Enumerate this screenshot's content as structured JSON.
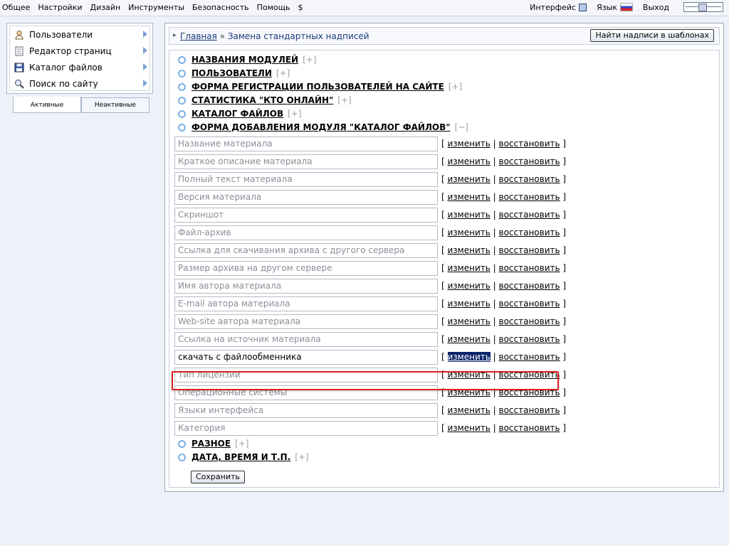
{
  "topmenu": [
    "Общее",
    "Настройки",
    "Дизайн",
    "Инструменты",
    "Безопасность",
    "Помощь",
    "$"
  ],
  "topright": {
    "interface_label": "Интерфейс",
    "language_label": "Язык",
    "logout_label": "Выход"
  },
  "sidebar": {
    "items": [
      {
        "label": "Пользователи",
        "icon": "user-icon"
      },
      {
        "label": "Редактор страниц",
        "icon": "page-icon"
      },
      {
        "label": "Каталог файлов",
        "icon": "disk-icon"
      },
      {
        "label": "Поиск по сайту",
        "icon": "search-icon"
      }
    ],
    "tabs": {
      "active": "Активные",
      "inactive": "Неактивные"
    }
  },
  "header": {
    "breadcrumb_home": "Главная",
    "breadcrumb_sep": " » ",
    "breadcrumb_current": "Замена стандартных надписей",
    "find_button": "Найти надписи в шаблонах"
  },
  "sections_top": [
    {
      "title": "НАЗВАНИЯ МОДУЛЕЙ",
      "toggle": "[+]"
    },
    {
      "title": "ПОЛЬЗОВАТЕЛИ",
      "toggle": "[+]"
    },
    {
      "title": "ФОРМА РЕГИСТРАЦИИ ПОЛЬЗОВАТЕЛЕЙ НА САЙТЕ",
      "toggle": "[+]"
    },
    {
      "title": "СТАТИСТИКА \"КТО ОНЛАЙН\"",
      "toggle": "[+]"
    },
    {
      "title": "КАТАЛОГ ФАЙЛОВ",
      "toggle": "[+]"
    },
    {
      "title": "ФОРМА ДОБАВЛЕНИЯ МОДУЛЯ \"КАТАЛОГ ФАЙЛОВ\"",
      "toggle": "[−]"
    }
  ],
  "fields": [
    "Название материала",
    "Краткое описание материала",
    "Полный текст материала",
    "Версия материала",
    "Скриншот",
    "Файл-архив",
    "Ссылка для скачивания архива с другого сервера",
    "Размер архива на другом сервере",
    "Имя автора материала",
    "E-mail автора материала",
    "Web-site автора материала",
    "Ссылка на источник материала",
    "скачать с файлообменника",
    "Тип лицензии",
    "Операционные системы",
    "Языки интерфейса",
    "Категория"
  ],
  "field_links": {
    "edit": "изменить",
    "restore": "восстановить",
    "open": "[ ",
    "mid": " | ",
    "close": " ]"
  },
  "sections_bottom": [
    {
      "title": "РАЗНОЕ",
      "toggle": "[+]"
    },
    {
      "title": "ДАТА, ВРЕМЯ И Т.П.",
      "toggle": "[+]"
    }
  ],
  "save_button": "Сохранить"
}
